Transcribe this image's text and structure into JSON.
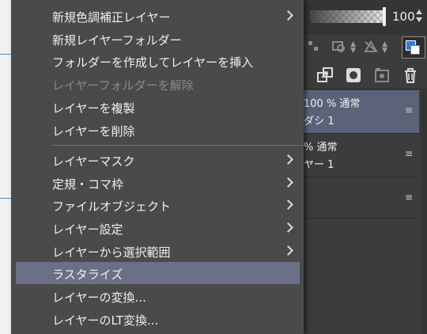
{
  "menu": {
    "items": [
      {
        "label": "新規色調補正レイヤー",
        "submenu": true,
        "disabled": false,
        "highlighted": false
      },
      {
        "label": "新規レイヤーフォルダー",
        "submenu": false,
        "disabled": false,
        "highlighted": false
      },
      {
        "label": "フォルダーを作成してレイヤーを挿入",
        "submenu": false,
        "disabled": false,
        "highlighted": false
      },
      {
        "label": "レイヤーフォルダーを解除",
        "submenu": false,
        "disabled": true,
        "highlighted": false
      },
      {
        "label": "レイヤーを複製",
        "submenu": false,
        "disabled": false,
        "highlighted": false
      },
      {
        "label": "レイヤーを削除",
        "submenu": false,
        "disabled": false,
        "highlighted": false
      },
      {
        "label": "レイヤーマスク",
        "submenu": true,
        "disabled": false,
        "highlighted": false
      },
      {
        "label": "定規・コマ枠",
        "submenu": true,
        "disabled": false,
        "highlighted": false
      },
      {
        "label": "ファイルオブジェクト",
        "submenu": true,
        "disabled": false,
        "highlighted": false
      },
      {
        "label": "レイヤー設定",
        "submenu": true,
        "disabled": false,
        "highlighted": false
      },
      {
        "label": "レイヤーから選択範囲",
        "submenu": true,
        "disabled": false,
        "highlighted": false
      },
      {
        "label": "ラスタライズ",
        "submenu": false,
        "disabled": false,
        "highlighted": true
      },
      {
        "label": "レイヤーの変換...",
        "submenu": false,
        "disabled": false,
        "highlighted": false
      },
      {
        "label": "レイヤーのLT変換...",
        "submenu": false,
        "disabled": false,
        "highlighted": false
      }
    ]
  },
  "layer_panel": {
    "opacity_value": "100",
    "layers": [
      {
        "line1": "100 % 通常",
        "line2": "ダシ 1",
        "selected": true
      },
      {
        "line1": "% 通常",
        "line2": "ヤー 1",
        "selected": false
      },
      {
        "line1": "",
        "line2": "",
        "selected": false
      }
    ],
    "grip_glyph": "≡"
  },
  "colors": {
    "menu_bg": "#4a4a4a",
    "menu_highlight": "#6a7186",
    "layer_selected": "#5b6378",
    "main_color": "#2b7fe0",
    "sub_color": "#ffffff"
  }
}
